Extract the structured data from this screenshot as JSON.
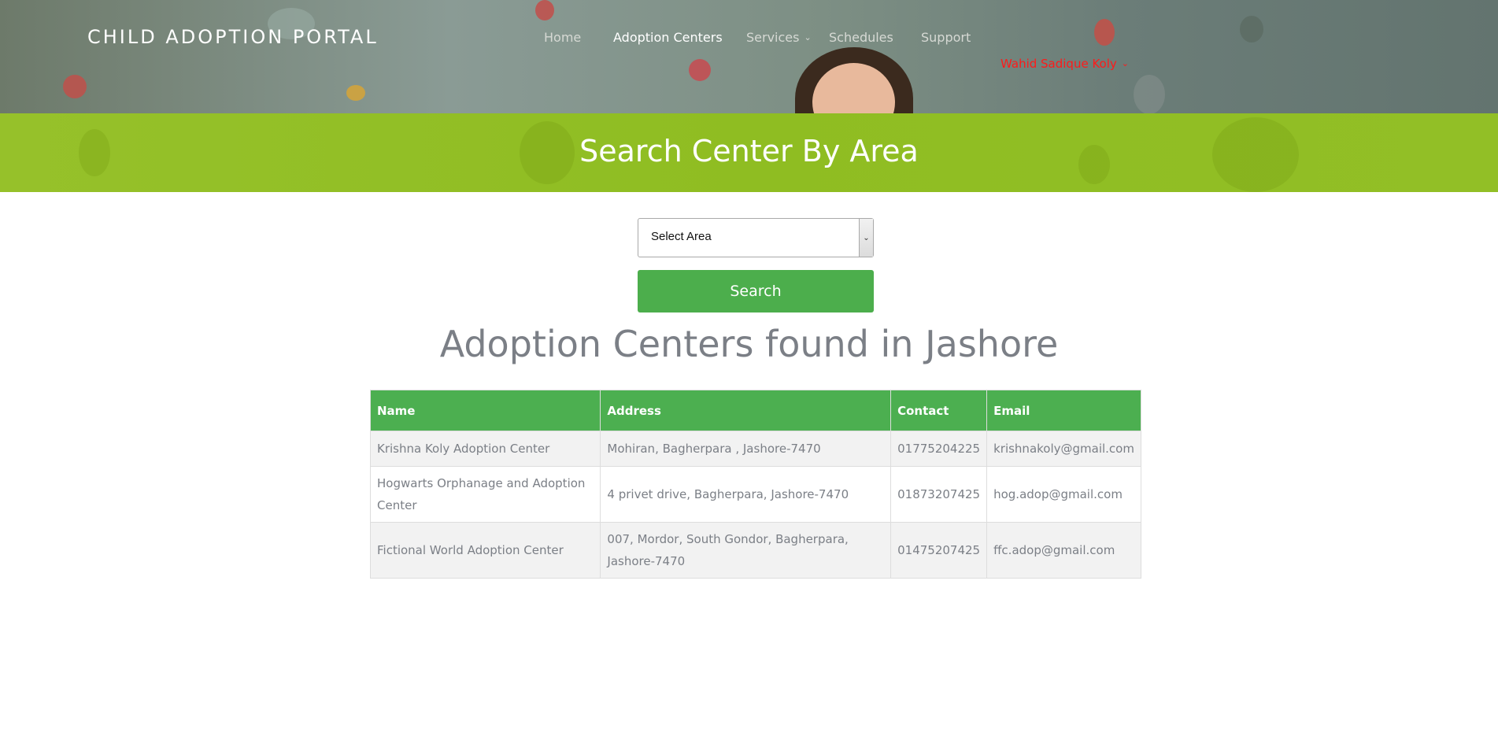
{
  "header": {
    "brand": "CHILD ADOPTION PORTAL",
    "nav": [
      {
        "label": "Home"
      },
      {
        "label": "Adoption Centers"
      },
      {
        "label": "Services"
      },
      {
        "label": "Schedules"
      },
      {
        "label": "Support"
      }
    ],
    "user": "Wahid Sadique Koly"
  },
  "banner": {
    "title": "Search Center By Area"
  },
  "search": {
    "select_value": "Select Area",
    "button_label": "Search"
  },
  "results": {
    "title": "Adoption Centers found in Jashore",
    "columns": [
      "Name",
      "Address",
      "Contact",
      "Email"
    ],
    "rows": [
      [
        "Krishna Koly Adoption Center",
        "Mohiran, Bagherpara , Jashore-7470",
        "01775204225",
        "krishnakoly@gmail.com"
      ],
      [
        "Hogwarts Orphanage and Adoption Center",
        "4 privet drive, Bagherpara, Jashore-7470",
        "01873207425",
        "hog.adop@gmail.com"
      ],
      [
        "Fictional World Adoption Center",
        "007, Mordor, South Gondor, Bagherpara, Jashore-7470",
        "01475207425",
        "ffc.adop@gmail.com"
      ]
    ]
  },
  "colors": {
    "accent_green": "#4caf50",
    "banner_green": "#8fbd22",
    "user_red": "#ff1a1a"
  }
}
